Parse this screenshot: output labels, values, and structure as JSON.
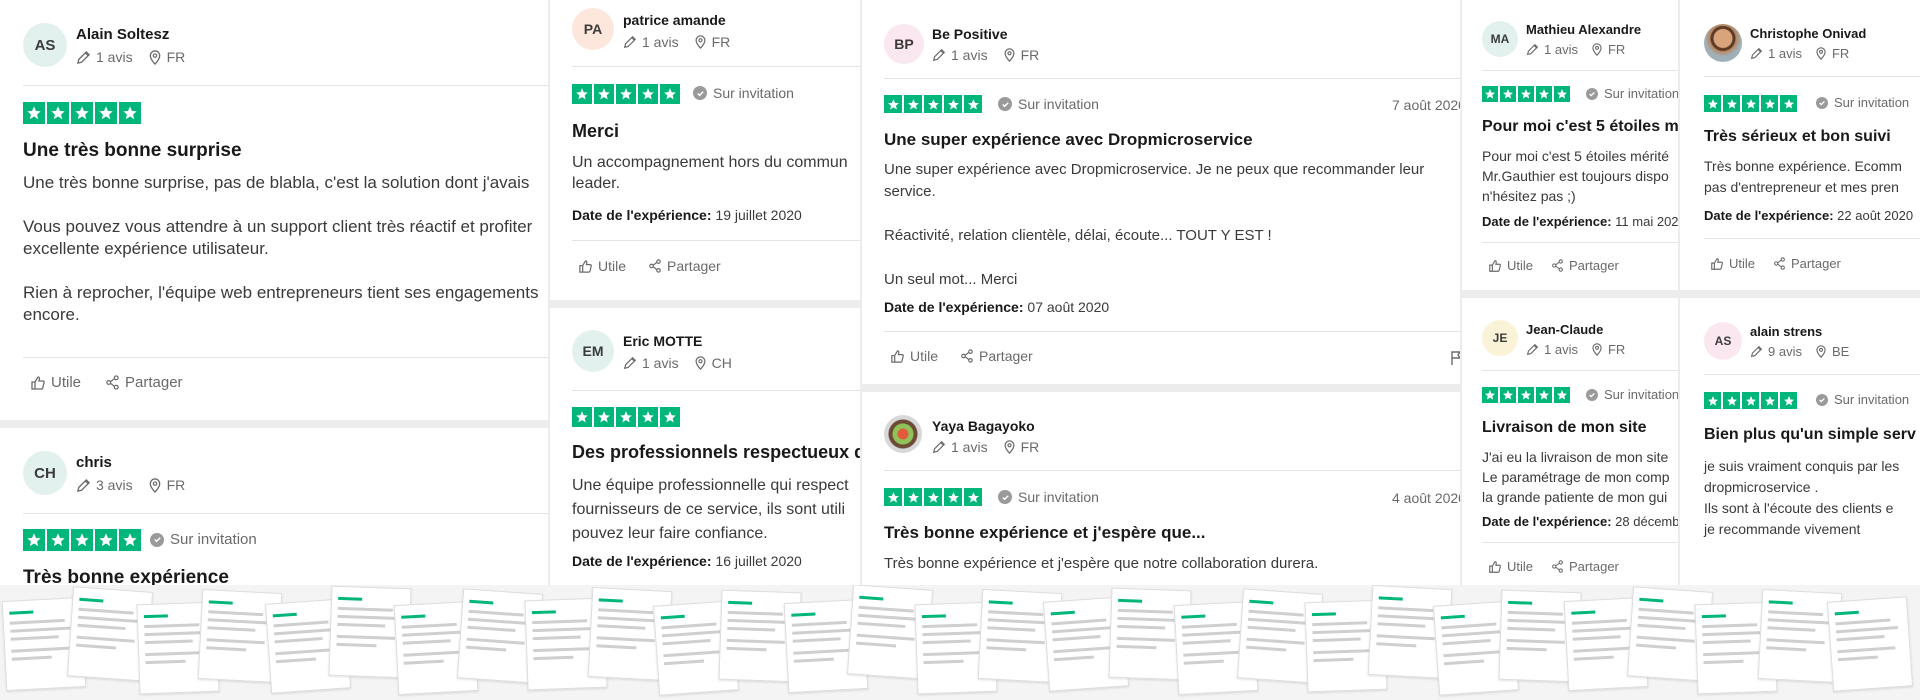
{
  "icons": {
    "pencil": "pencil-icon",
    "location": "location-pin-icon",
    "check": "check-circle-icon",
    "like": "thumbs-up-icon",
    "share": "share-icon"
  },
  "colors": {
    "star_green": "#00b67a",
    "avatar_mint": "#e3f1ee",
    "avatar_peach": "#fde7dd",
    "avatar_pink": "#fbe7ef",
    "avatar_yellow": "#fbf3d7"
  },
  "common": {
    "helpful": "Utile",
    "share": "Partager",
    "invitation": "Sur invitation",
    "experience_label": "Date de l'expérience:"
  },
  "reviews": {
    "alain": {
      "initials": "AS",
      "name": "Alain Soltesz",
      "reviews": "1 avis",
      "country": "FR",
      "rating": 5,
      "title": "Une très bonne surprise",
      "body": "Une très bonne surprise, pas de blabla, c'est la solution dont j'avais\n\nVous pouvez vous attendre à un support client très réactif et profiter\nexcellente expérience utilisateur.\n\nRien à reprocher, l'équipe web entrepreneurs tient ses engagements\nencore."
    },
    "chris": {
      "initials": "CH",
      "name": "chris",
      "reviews": "3 avis",
      "country": "FR",
      "rating": 5,
      "title": "Très bonne expérience"
    },
    "patrice": {
      "initials": "PA",
      "name": "patrice amande",
      "reviews": "1 avis",
      "country": "FR",
      "rating": 5,
      "title": "Merci",
      "body": "Un accompagnement hors du commun\nleader.",
      "experience_date": "19 juillet 2020"
    },
    "eric": {
      "initials": "EM",
      "name": "Eric MOTTE",
      "reviews": "1 avis",
      "country": "CH",
      "rating": 5,
      "title": "Des professionnels respectueux d",
      "body": "Une équipe professionnelle qui respect\nfournisseurs de ce service, ils sont utili\npouvez leur faire confiance.",
      "experience_date": "16 juillet 2020"
    },
    "bepositive": {
      "initials": "BP",
      "name": "Be Positive",
      "reviews": "1 avis",
      "country": "FR",
      "rating": 5,
      "date": "7 août 2020",
      "title": "Une super expérience avec Dropmicroservice",
      "body": "Une super expérience avec Dropmicroservice. Je ne peux que recommander leur\nservice.\n\nRéactivité, relation clientèle, délai, écoute... TOUT Y EST !\n\nUn seul mot... Merci",
      "experience_date": "07 août 2020"
    },
    "yaya": {
      "name": "Yaya Bagayoko",
      "reviews": "1 avis",
      "country": "FR",
      "rating": 5,
      "date": "4 août 2020",
      "title": "Très bonne expérience et j'espère que...",
      "body": "Très bonne expérience et j'espère que notre collaboration durera."
    },
    "mathieu": {
      "initials": "MA",
      "name": "Mathieu Alexandre",
      "reviews": "1 avis",
      "country": "FR",
      "rating": 5,
      "title": "Pour moi c'est 5 étoiles m",
      "body": "Pour moi c'est 5 étoiles mérité\nMr.Gauthier est toujours dispo\nn'hésitez pas ;)",
      "experience_date": "11 mai 2021"
    },
    "jeanclaude": {
      "initials": "JE",
      "name": "Jean-Claude",
      "reviews": "1 avis",
      "country": "FR",
      "rating": 5,
      "title": "Livraison de mon site",
      "body": "J'ai eu la livraison de mon site\nLe paramétrage de mon comp\nla grande patiente de mon gui",
      "experience_date": "28 décembr"
    },
    "christophe": {
      "name": "Christophe Onivad",
      "reviews": "1 avis",
      "country": "FR",
      "rating": 5,
      "title": "Très sérieux et bon suivi",
      "body": "Très bonne expérience. Ecomm\npas d'entrepreneur et mes pren",
      "experience_date": "22 août 2020"
    },
    "alainstrens": {
      "initials": "AS",
      "name": "alain strens",
      "reviews": "9 avis",
      "country": "BE",
      "rating": 5,
      "title": "Bien plus qu'un simple serv",
      "body": "je suis vraiment conquis par les\ndropmicroservice .\nIls sont à l'écoute des clients e\nje recommande vivement"
    }
  }
}
